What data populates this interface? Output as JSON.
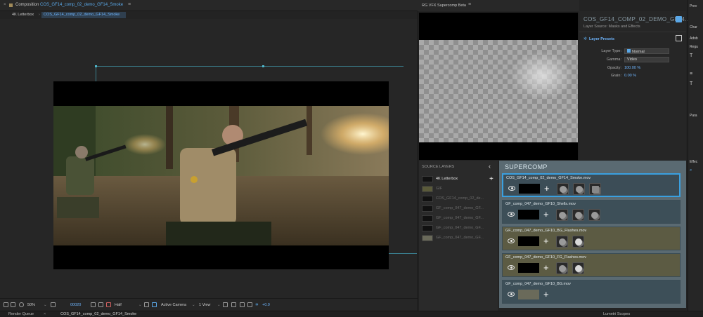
{
  "comp": {
    "header_prefix": "Composition",
    "header_name": "COS_GF14_comp_02_demo_GF14_Smoke",
    "tabs": [
      "4K Letterbox",
      "COS_GF14_comp_02_demo_GF14_Smoke"
    ],
    "toolbar": {
      "zoom": "50%",
      "timecode": "00020",
      "resolution": "Half",
      "camera": "Active Camera",
      "views": "1 View",
      "exposure": "+0.0"
    }
  },
  "rg": {
    "title": "RG VFX Supercomp Beta",
    "layer_title": "COS_GF14_COMP_02_DEMO_GF14...",
    "layer_source": "Layer Source: Masks and Effects",
    "presets_label": "Layer Presets",
    "layer_type_label": "Layer Type:",
    "layer_type_value": "Normal",
    "gamma_label": "Gamma:",
    "gamma_value": "Video",
    "opacity_label": "Opacity:",
    "opacity_value": "100.00 %",
    "grain_label": "Grain:",
    "grain_value": "0.00 %",
    "source_layers_title": "SOURCE LAYERS",
    "source_layers": [
      "4K Letterbox",
      "GIF",
      "COS_GF14_comp_02_de...",
      "GF_comp_047_demo_GF...",
      "GF_comp_047_demo_GF...",
      "GF_comp_047_demo_GF...",
      "GF_comp_047_demo_GF..."
    ],
    "supercomp_title": "SUPERCOMP",
    "layers": [
      {
        "name": "COS_GF14_comp_02_demo_GF14_Smoke.mov",
        "effects": 3
      },
      {
        "name": "GF_comp_047_demo_GF10_Shells.mov",
        "effects": 3
      },
      {
        "name": "GF_comp_047_demo_GF10_BG_Flashes.mov",
        "effects": 2
      },
      {
        "name": "GF_comp_047_demo_GF10_FG_Flashes.mov",
        "effects": 2
      },
      {
        "name": "GF_comp_047_demo_GF10_BG.mov",
        "effects": 0
      }
    ]
  },
  "far_right": {
    "labels": [
      "Prev",
      "Char",
      "Adob",
      "Regu",
      "Para",
      "Effec"
    ]
  },
  "bottom_tabs": [
    "Render Queue",
    "COS_GF14_comp_02_demo_GF14_Smoke",
    "Lumetri Scopes"
  ],
  "colors": {
    "accent": "#5aa8e8",
    "supercomp_bg": "#5a6a72",
    "selected_layer_border": "#3aa0e0",
    "yellow_layer_bg": "#5c5b43"
  }
}
